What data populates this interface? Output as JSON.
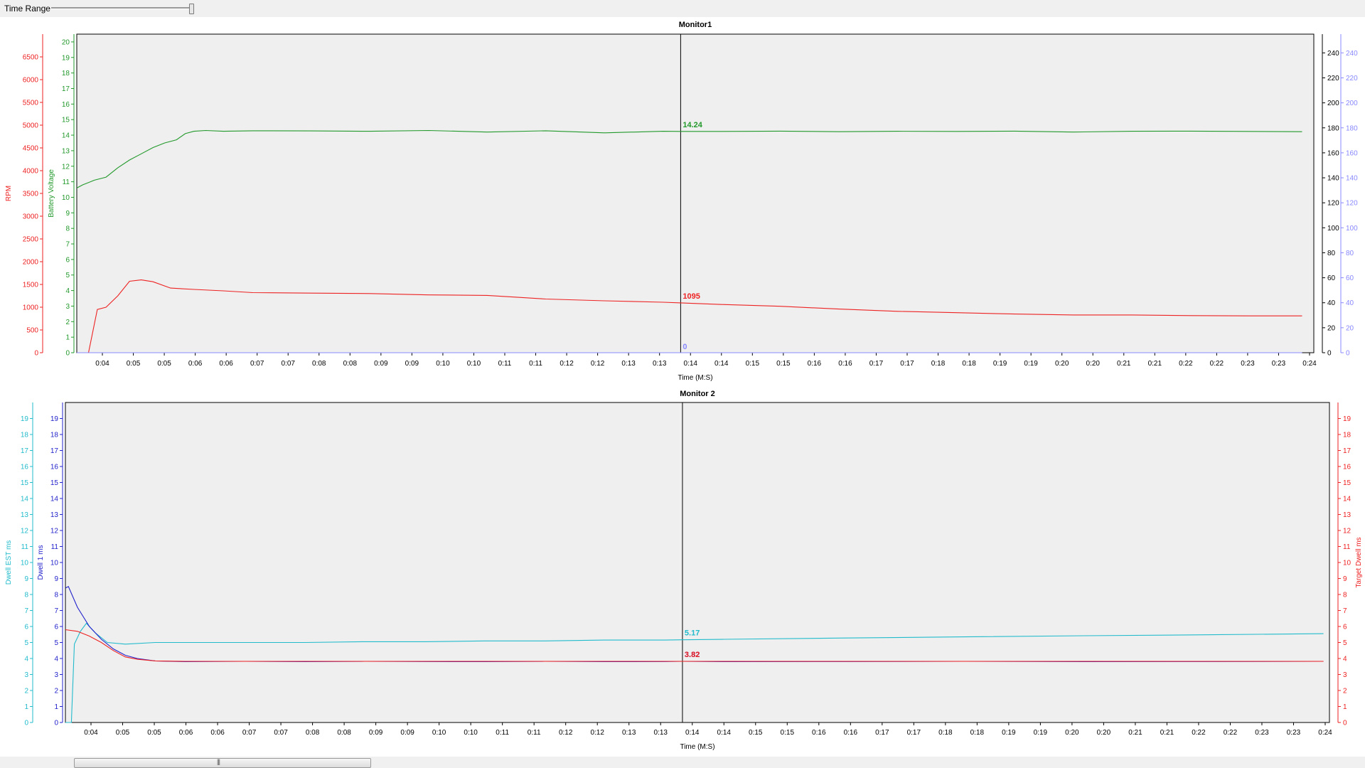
{
  "controls": {
    "time_range_label": "Time Range",
    "slider_level": 0.98
  },
  "colors": {
    "rpm": "#ee2222",
    "battery": "#22992b",
    "blue_axis": "#8888ff",
    "dwell_est": "#22bbcc",
    "dwell1": "#2222cc",
    "target_dwell": "#ee2222",
    "plot_bg": "#efefef"
  },
  "cursor_time": "0:13",
  "time_ticks": [
    "0:04",
    "0:05",
    "0:05",
    "0:06",
    "0:06",
    "0:07",
    "0:07",
    "0:08",
    "0:08",
    "0:09",
    "0:09",
    "0:10",
    "0:10",
    "0:11",
    "0:11",
    "0:12",
    "0:12",
    "0:13",
    "0:13",
    "0:14",
    "0:14",
    "0:15",
    "0:15",
    "0:16",
    "0:16",
    "0:17",
    "0:17",
    "0:18",
    "0:18",
    "0:19",
    "0:19",
    "0:20",
    "0:20",
    "0:21",
    "0:21",
    "0:22",
    "0:22",
    "0:23",
    "0:23",
    "0:24"
  ],
  "chart_data": [
    {
      "type": "line",
      "title": "Monitor1",
      "xlabel": "Time (M:S)",
      "xlim": [
        3.0,
        24.1
      ],
      "axes": [
        {
          "id": "rpm",
          "label": "RPM",
          "side": "left",
          "range": [
            0,
            7000
          ],
          "ticks": [
            0,
            500,
            1000,
            1500,
            2000,
            2500,
            3000,
            3500,
            4000,
            4500,
            5000,
            5500,
            6000,
            6500
          ]
        },
        {
          "id": "volt",
          "label": "Battery Voltage",
          "side": "left",
          "range": [
            0,
            20.5
          ],
          "ticks": [
            0,
            1,
            2,
            3,
            4,
            5,
            6,
            7,
            8,
            9,
            10,
            11,
            12,
            13,
            14,
            15,
            16,
            17,
            18,
            19,
            20
          ]
        },
        {
          "id": "right_black",
          "label": "",
          "side": "right",
          "range": [
            0,
            255
          ],
          "ticks": [
            0,
            20,
            40,
            60,
            80,
            100,
            120,
            140,
            160,
            180,
            200,
            220,
            240
          ]
        },
        {
          "id": "right_blue",
          "label": "",
          "side": "right",
          "range": [
            0,
            255
          ],
          "ticks": [
            0,
            20,
            40,
            60,
            80,
            100,
            120,
            140,
            160,
            180,
            200,
            220,
            240
          ]
        }
      ],
      "series": [
        {
          "axis": "volt",
          "color_key": "battery",
          "cursor_label": "14.24",
          "x": [
            3.0,
            3.1,
            3.3,
            3.5,
            3.7,
            3.9,
            4.1,
            4.3,
            4.5,
            4.7,
            4.85,
            5.0,
            5.2,
            5.5,
            6.0,
            7.0,
            8.0,
            9.0,
            10.0,
            11.0,
            12.0,
            13.0,
            13.3,
            14.0,
            15.0,
            16.0,
            17.0,
            18.0,
            19.0,
            20.0,
            21.0,
            22.0,
            23.0,
            23.9
          ],
          "y": [
            10.6,
            10.8,
            11.1,
            11.3,
            11.9,
            12.4,
            12.8,
            13.2,
            13.5,
            13.7,
            14.1,
            14.25,
            14.3,
            14.25,
            14.28,
            14.27,
            14.25,
            14.3,
            14.2,
            14.28,
            14.15,
            14.25,
            14.24,
            14.24,
            14.26,
            14.22,
            14.25,
            14.24,
            14.26,
            14.2,
            14.25,
            14.26,
            14.24,
            14.22
          ]
        },
        {
          "axis": "rpm",
          "color_key": "rpm",
          "cursor_label": "1095",
          "x": [
            3.0,
            3.2,
            3.35,
            3.5,
            3.7,
            3.9,
            4.1,
            4.3,
            4.6,
            5.0,
            5.5,
            6.0,
            7.0,
            8.0,
            9.0,
            10.0,
            10.5,
            11.0,
            12.0,
            13.0,
            13.3,
            14.0,
            15.0,
            16.0,
            17.0,
            18.0,
            19.0,
            20.0,
            21.0,
            22.0,
            23.0,
            23.9
          ],
          "y": [
            0,
            0,
            950,
            1000,
            1250,
            1570,
            1600,
            1560,
            1420,
            1390,
            1360,
            1320,
            1310,
            1300,
            1270,
            1260,
            1220,
            1180,
            1140,
            1110,
            1095,
            1060,
            1020,
            960,
            910,
            880,
            850,
            830,
            830,
            815,
            810,
            810
          ]
        },
        {
          "axis": "right_blue",
          "color_key": "blue_axis",
          "cursor_label": "0",
          "x": [
            3.0,
            23.9
          ],
          "y": [
            0,
            0
          ]
        }
      ]
    },
    {
      "type": "line",
      "title": "Monitor 2",
      "xlabel": "Time (M:S)",
      "xlim": [
        3.0,
        24.1
      ],
      "axes": [
        {
          "id": "est",
          "label": "Dwell EST ms",
          "side": "left",
          "range": [
            0,
            20
          ],
          "ticks": [
            0,
            1,
            2,
            3,
            4,
            5,
            6,
            7,
            8,
            9,
            10,
            11,
            12,
            13,
            14,
            15,
            16,
            17,
            18,
            19
          ]
        },
        {
          "id": "dw1",
          "label": "Dwell 1 ms",
          "side": "left",
          "range": [
            0,
            20
          ],
          "ticks": [
            0,
            1,
            2,
            3,
            4,
            5,
            6,
            7,
            8,
            9,
            10,
            11,
            12,
            13,
            14,
            15,
            16,
            17,
            18,
            19
          ]
        },
        {
          "id": "tgt",
          "label": "Target Dwell ms",
          "side": "right",
          "range": [
            0,
            20
          ],
          "ticks": [
            0,
            1,
            2,
            3,
            4,
            5,
            6,
            7,
            8,
            9,
            10,
            11,
            12,
            13,
            14,
            15,
            16,
            17,
            18,
            19
          ]
        }
      ],
      "series": [
        {
          "axis": "est",
          "color_key": "dwell_est",
          "cursor_label": "5.17",
          "x": [
            3.0,
            3.1,
            3.15,
            3.25,
            3.35,
            3.5,
            3.7,
            4.0,
            4.5,
            5.0,
            6.0,
            7.0,
            8.0,
            9.0,
            10.0,
            11.0,
            12.0,
            13.0,
            13.3,
            14.0,
            16.0,
            18.0,
            20.0,
            22.0,
            24.0
          ],
          "y": [
            0,
            0,
            4.9,
            5.7,
            6.2,
            5.6,
            5.0,
            4.9,
            5.0,
            5.0,
            5.0,
            5.0,
            5.05,
            5.05,
            5.1,
            5.1,
            5.15,
            5.15,
            5.17,
            5.2,
            5.28,
            5.35,
            5.42,
            5.48,
            5.55
          ]
        },
        {
          "axis": "dw1",
          "color_key": "dwell1",
          "cursor_label": "3.82",
          "x": [
            3.0,
            3.05,
            3.2,
            3.4,
            3.6,
            3.8,
            4.0,
            4.2,
            4.5,
            5.0,
            6.0,
            7.0,
            8.0,
            9.0,
            10.0,
            11.0,
            12.0,
            13.0,
            13.3,
            14.0,
            16.0,
            18.0,
            20.0,
            22.0,
            24.0
          ],
          "y": [
            8.4,
            8.5,
            7.2,
            6.0,
            5.2,
            4.6,
            4.2,
            4.0,
            3.85,
            3.8,
            3.82,
            3.8,
            3.82,
            3.81,
            3.8,
            3.82,
            3.8,
            3.81,
            3.82,
            3.8,
            3.81,
            3.82,
            3.8,
            3.81,
            3.82
          ]
        },
        {
          "axis": "tgt",
          "color_key": "target_dwell",
          "cursor_label": "3.82",
          "x": [
            3.0,
            3.2,
            3.4,
            3.6,
            3.8,
            4.0,
            4.2,
            4.5,
            5.0,
            6.0,
            8.0,
            10.0,
            12.0,
            13.3,
            16.0,
            20.0,
            24.0
          ],
          "y": [
            5.8,
            5.7,
            5.4,
            5.0,
            4.5,
            4.1,
            3.95,
            3.85,
            3.82,
            3.82,
            3.82,
            3.82,
            3.82,
            3.82,
            3.82,
            3.82,
            3.82
          ]
        }
      ]
    }
  ]
}
